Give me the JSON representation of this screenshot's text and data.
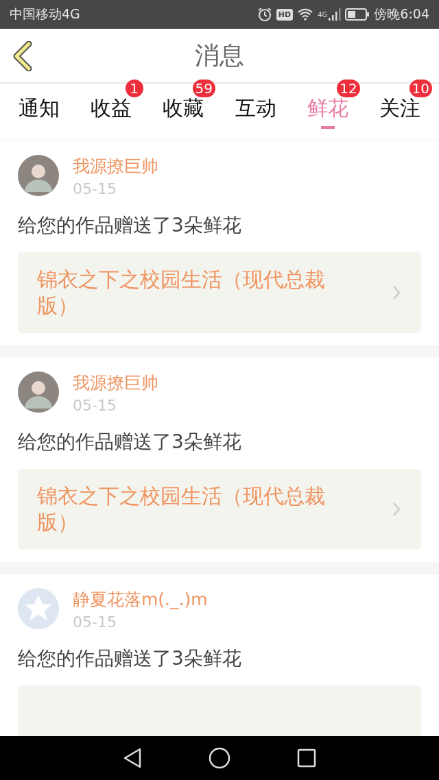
{
  "status_bar": {
    "carrier": "中国移动4G",
    "hd": "HD",
    "network": "4G",
    "time": "傍晚6:04"
  },
  "header": {
    "title": "消息"
  },
  "tabs": [
    {
      "label": "通知",
      "selected": false
    },
    {
      "label": "收益",
      "selected": false,
      "badge": "1"
    },
    {
      "label": "收藏",
      "selected": false,
      "badge": "59"
    },
    {
      "label": "互动",
      "selected": false
    },
    {
      "label": "鲜花",
      "selected": true,
      "badge": "12"
    },
    {
      "label": "关注",
      "selected": false,
      "badge": "10"
    }
  ],
  "messages": [
    {
      "avatar": {
        "kind": "photo"
      },
      "name": "我源撩巨帅",
      "date": "05-15",
      "text": "给您的作品赠送了3朵鲜花",
      "work": "锦衣之下之校园生活（现代总裁版）"
    },
    {
      "avatar": {
        "kind": "photo"
      },
      "name": "我源撩巨帅",
      "date": "05-15",
      "text": "给您的作品赠送了3朵鲜花",
      "work": "锦衣之下之校园生活（现代总裁版）"
    },
    {
      "avatar": {
        "kind": "default"
      },
      "name": "静夏花落m(._.)m",
      "date": "05-15",
      "text": "给您的作品赠送了3朵鲜花"
    }
  ]
}
